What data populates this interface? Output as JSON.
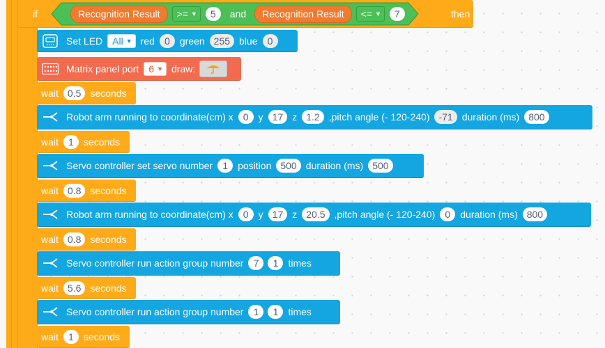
{
  "if_block": {
    "if_label": "if",
    "left_sensor": "Recognition Result",
    "left_op": ">=",
    "left_value": "5",
    "and_label": "and",
    "right_sensor": "Recognition Result",
    "right_op": "<=",
    "right_value": "7",
    "then_label": "then"
  },
  "set_led": {
    "label": "Set LED",
    "target": "All",
    "red_label": "red",
    "red_value": "0",
    "green_label": "green",
    "green_value": "255",
    "blue_label": "blue",
    "blue_value": "0"
  },
  "matrix": {
    "label": "Matrix panel port",
    "port": "6",
    "draw_label": "draw:"
  },
  "wait_label": "wait",
  "seconds_label": "seconds",
  "waits": [
    "0.5",
    "1",
    "0.8",
    "0.8",
    "5.6",
    "1"
  ],
  "arm_label": "Robot arm running to coordinate(cm) x",
  "y_label": "y",
  "z_label": "z",
  "pitch_label": ",pitch angle (- 120-240)",
  "duration_label": "duration (ms)",
  "arm1": {
    "x": "0",
    "y": "17",
    "z": "1.2",
    "pitch": "-71",
    "duration": "800"
  },
  "arm2": {
    "x": "0",
    "y": "17",
    "z": "20.5",
    "pitch": "0",
    "duration": "800"
  },
  "servo_set": {
    "label": "Servo controller set servo number",
    "number": "1",
    "position_label": "position",
    "position": "500",
    "duration_label": "duration (ms)",
    "duration": "500"
  },
  "action1": {
    "label": "Servo controller run action group number",
    "group": "7",
    "times": "1",
    "times_label": "times"
  },
  "action2": {
    "label": "Servo controller run action group number",
    "group": "1",
    "times": "1",
    "times_label": "times"
  },
  "colors": {
    "blue": "#14a6e0",
    "orange": "#ffab19",
    "red": "#f36b4e",
    "green": "#4cbf56",
    "recognition": "#f07b2e"
  }
}
